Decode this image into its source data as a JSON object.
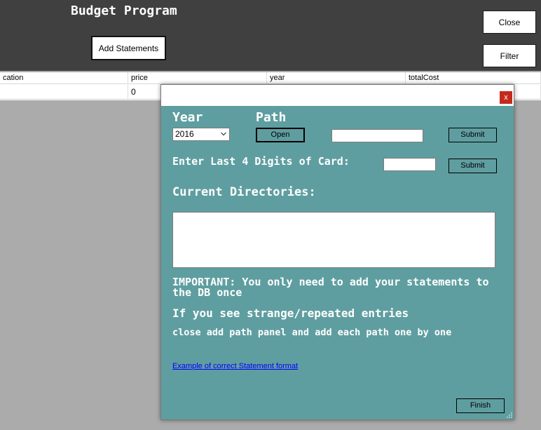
{
  "main_window": {
    "title": "Budget Program",
    "add_statements_label": "Add Statements",
    "close_label": "Close",
    "filter_label": "Filter"
  },
  "grid": {
    "columns": [
      "cation",
      "price",
      "year",
      "totalCost"
    ],
    "rows": [
      [
        "",
        "0",
        "",
        ""
      ]
    ]
  },
  "dialog": {
    "close_glyph": "x",
    "year_label": "Year",
    "path_label": "Path",
    "year_selected": "2016",
    "open_label": "Open",
    "path_value": "",
    "submit_label": "Submit",
    "card_label": "Enter Last 4 Digits of Card:",
    "card_value": "",
    "submit_card_label": "Submit",
    "directories_label": "Current Directories:",
    "directories_content": "",
    "important_text": "IMPORTANT: You only need to add your statements to the DB once",
    "strange_text": "If you see strange/repeated entries",
    "close_panel_text": "close add path panel and add each path one by one",
    "example_link": "Example of correct Statement format",
    "finish_label": "Finish"
  },
  "colors": {
    "banner": "#404040",
    "dialog_bg": "#5f9ea0",
    "close_red": "#c42b1c",
    "link_blue": "#0000ff"
  },
  "icons": [
    "chevron-down-icon",
    "close-icon",
    "resize-grip-icon"
  ]
}
